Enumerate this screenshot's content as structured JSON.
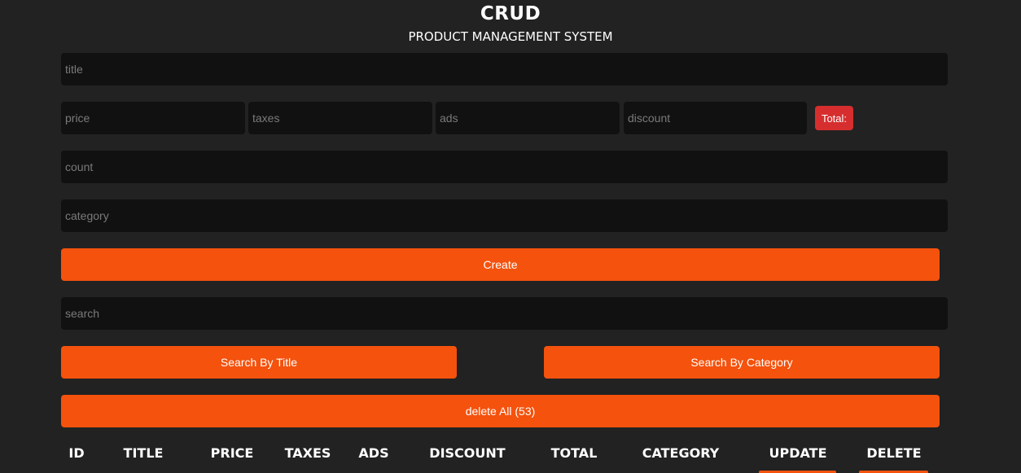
{
  "header": {
    "title": "CRUD",
    "subtitle": "PRODUCT MANAGEMENT SYSTEM"
  },
  "form": {
    "title_placeholder": "title",
    "price_placeholder": "price",
    "taxes_placeholder": "taxes",
    "ads_placeholder": "ads",
    "discount_placeholder": "discount",
    "total_label": "Total:",
    "count_placeholder": "count",
    "category_placeholder": "category",
    "create_label": "Create"
  },
  "search": {
    "placeholder": "search",
    "by_title_label": "Search By Title",
    "by_category_label": "Search By Category"
  },
  "delete_all_label": "delete All (53)",
  "table": {
    "columns": [
      "ID",
      "TITLE",
      "PRICE",
      "TAXES",
      "ADS",
      "DISCOUNT",
      "TOTAL",
      "CATEGORY",
      "UPDATE",
      "DELETE"
    ]
  },
  "colors": {
    "background": "#222222",
    "input_bg": "#111111",
    "accent": "#f4520d",
    "total_badge": "#d62e2e"
  }
}
